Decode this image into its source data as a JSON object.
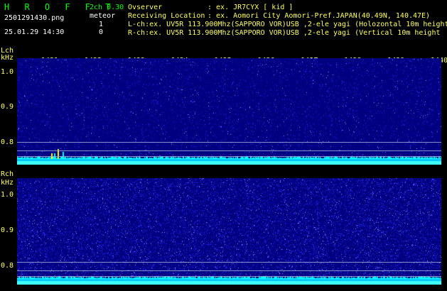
{
  "header": {
    "logo": "H R O F F T",
    "version": "2ch 0.30",
    "filename": "2501291430.png",
    "datetime": "25.01.29 14:30",
    "meteor_label": "meteor",
    "meteor_lch": "1",
    "meteor_rch": "0",
    "observer_label": "Ovserver",
    "observer_value": ": ex. JR7CYX [ kid ]",
    "location_label": "Receiving Location",
    "location_value": ": ex. Aomori City Aomori-Pref.JAPAN(40.49N, 140.47E)",
    "lch_line": "L-ch:ex. UV5R 113.900Mhz(SAPPORO VOR)USB ,2-ele yagi (Holozontal 10m height",
    "rch_line": "R-ch:ex. UV5R 113.900Mhz(SAPPORO VOR)USB ,2-ele yagi (Vertical 10m height"
  },
  "x_ticks": [
    "1431",
    "1432",
    "1433",
    "1434",
    "1435",
    "1436",
    "1437",
    "1438",
    "1439",
    "1440"
  ],
  "lch": {
    "label": "Lch",
    "unit": "kHz",
    "y_ticks": [
      "1.0",
      "0.9",
      "0.8"
    ]
  },
  "rch": {
    "label": "Rch",
    "unit": "kHz",
    "y_ticks": [
      "1.0",
      "0.9",
      "0.8"
    ]
  },
  "colors": {
    "background": "#000000",
    "panel": "#000080",
    "signal": "#00ffff",
    "header_green": "#00ff00",
    "tick_yellow": "#ffff66"
  }
}
